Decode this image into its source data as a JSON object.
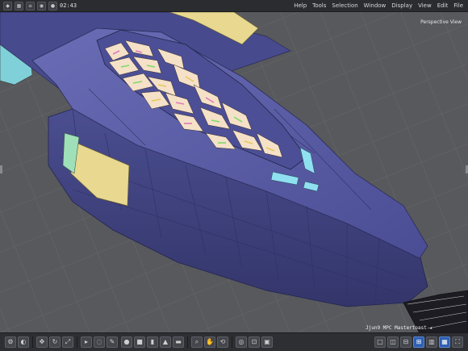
{
  "menubar": {
    "items": [
      "File",
      "Edit",
      "View",
      "Display",
      "Window",
      "Selection",
      "Tools",
      "Help"
    ],
    "time": "02:43"
  },
  "viewport": {
    "label": "Perspective View",
    "caption": "Jjun9 MPC Mastertoast ★"
  },
  "colors": {
    "hull": "#5a5da6",
    "hull_dark": "#3c3f7c",
    "panel_yellow": "#e8d890",
    "window_glow": "#f5e1c8",
    "accent_blue": "#2d5fb3"
  },
  "icons": {
    "toolbar": [
      "tool-icon",
      "grid-icon",
      "layers-icon",
      "camera-icon",
      "sphere-icon"
    ],
    "bottom": [
      "settings-icon",
      "render-icon",
      "move-icon",
      "rotate-icon",
      "scale-icon",
      "select-icon",
      "zoom-icon",
      "pan-icon",
      "orbit-icon",
      "view-icon"
    ]
  }
}
